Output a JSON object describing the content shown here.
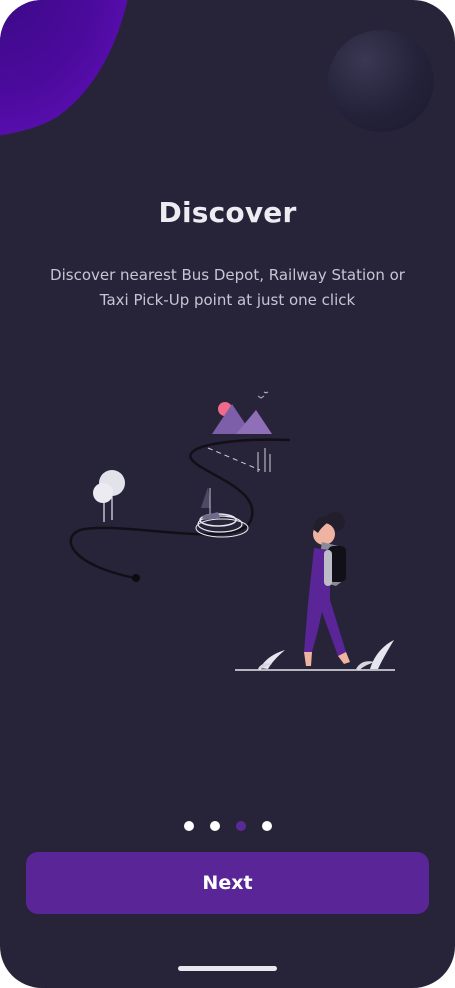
{
  "onboarding": {
    "title": "Discover",
    "subtitle": "Discover nearest Bus Depot, Railway Station or Taxi Pick-Up point at just one click",
    "page_indicator": {
      "total": 4,
      "current": 3
    },
    "next_label": "Next"
  },
  "colors": {
    "background": "#27243a",
    "accent": "#5a2597",
    "active_dot": "#5b2b95",
    "text": "#ececf2"
  },
  "icons": {
    "illustration": "travel-path-illustration",
    "moon": "moon-decoration",
    "blob": "purple-blob-decoration"
  }
}
